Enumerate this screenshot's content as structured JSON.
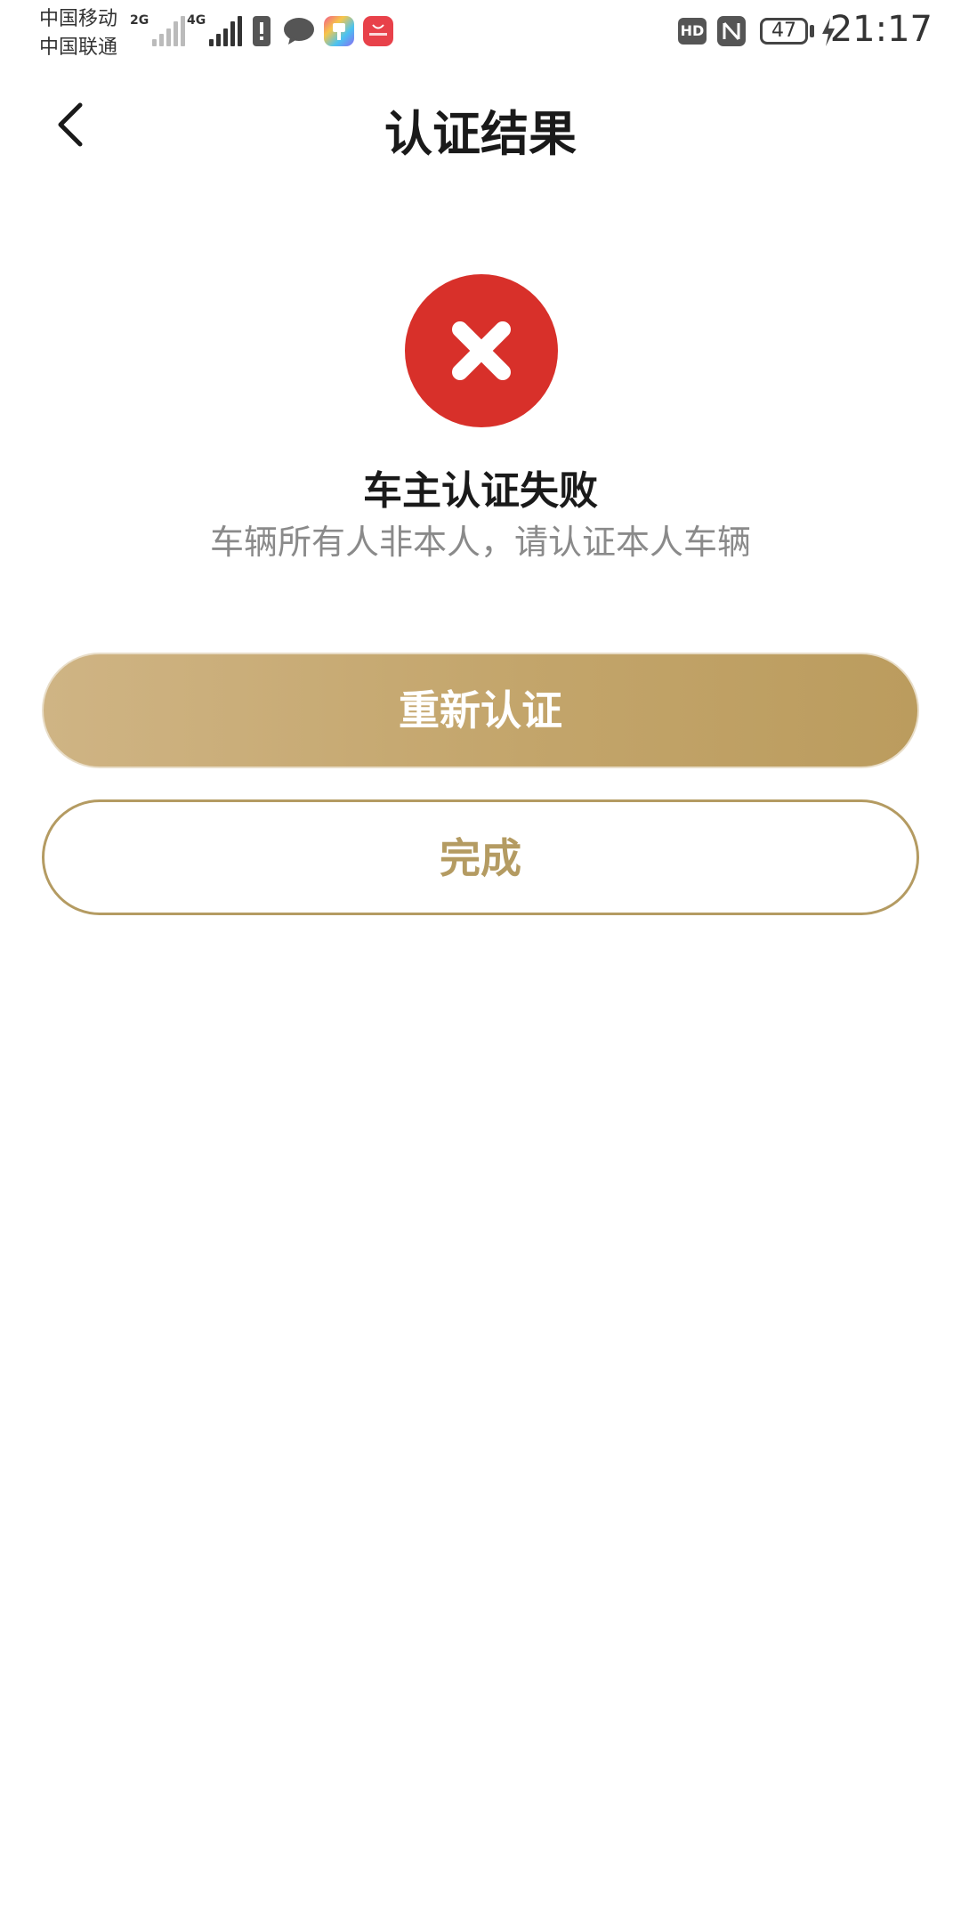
{
  "status_bar": {
    "carrier_1": "中国移动",
    "carrier_2": "中国联通",
    "network_1": "2G",
    "network_2": "4G",
    "hd_label": "HD",
    "battery": "47",
    "time": "21:17"
  },
  "header": {
    "title": "认证结果"
  },
  "result": {
    "status": "error",
    "icon": "close-icon",
    "title": "车主认证失败",
    "description": "车辆所有人非本人，请认证本人车辆"
  },
  "actions": {
    "retry_label": "重新认证",
    "done_label": "完成"
  },
  "colors": {
    "error": "#d8302a",
    "accent_gold": "#c3a56b",
    "outline_gold": "#b49b62"
  }
}
